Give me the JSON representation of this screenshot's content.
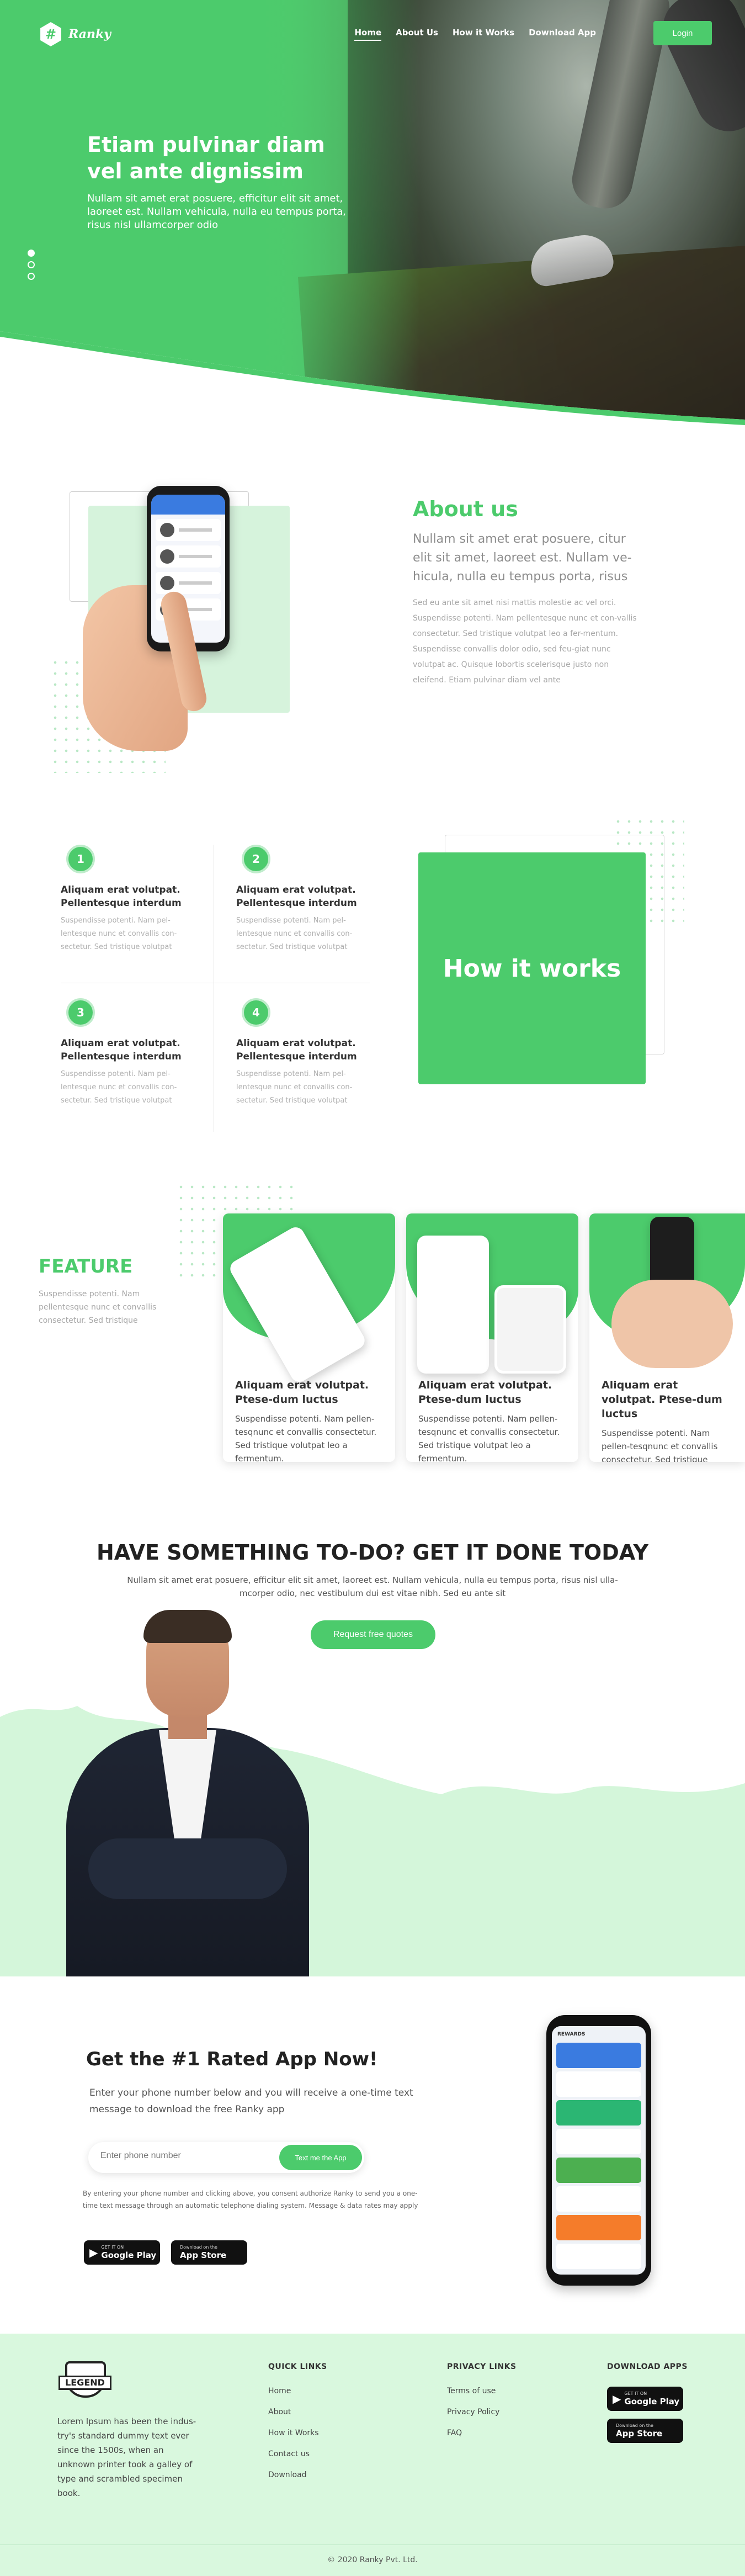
{
  "brand": {
    "name": "Ranky",
    "logo_glyph": "#"
  },
  "nav": {
    "items": [
      {
        "label": "Home",
        "active": true
      },
      {
        "label": "About Us",
        "active": false
      },
      {
        "label": "How it Works",
        "active": false
      },
      {
        "label": "Download App",
        "active": false
      }
    ],
    "login_label": "Login"
  },
  "hero": {
    "title_line1": "Etiam pulvinar diam",
    "title_line2": "vel ante dignissim",
    "subtitle": "Nullam sit amet erat posuere, efficitur elit sit amet, laoreet est. Nullam vehicula, nulla eu tempus porta, risus nisl ullamcorper odio",
    "slider_active_index": 0
  },
  "about": {
    "title": "About us",
    "lead": "Nullam sit amet erat posuere, citur elit sit amet, laoreet est. Nullam ve-hicula, nulla eu tempus porta, risus",
    "body": "Sed eu ante sit amet nisi mattis molestie ac vel orci. Suspendisse potenti. Nam pellentesque nunc et con-vallis consectetur. Sed tristique volutpat leo a fer-mentum. Suspendisse convallis dolor odio, sed feu-giat nunc volutpat ac. Quisque lobortis scelerisque justo non eleifend. Etiam pulvinar diam vel ante"
  },
  "how_it_works": {
    "title": "How it works",
    "steps": [
      {
        "number": "1",
        "title": "Aliquam erat volutpat. Pellentesque interdum",
        "text": "Suspendisse potenti. Nam pel-lentesque nunc et convallis con-sectetur. Sed tristique volutpat"
      },
      {
        "number": "2",
        "title": "Aliquam erat volutpat. Pellentesque interdum",
        "text": "Suspendisse potenti. Nam pel-lentesque nunc et convallis con-sectetur. Sed tristique volutpat"
      },
      {
        "number": "3",
        "title": "Aliquam erat volutpat. Pellentesque interdum",
        "text": "Suspendisse potenti. Nam pel-lentesque nunc et convallis con-sectetur. Sed tristique volutpat"
      },
      {
        "number": "4",
        "title": "Aliquam erat volutpat. Pellentesque interdum",
        "text": "Suspendisse potenti. Nam pel-lentesque nunc et convallis con-sectetur. Sed tristique volutpat"
      }
    ]
  },
  "feature": {
    "title": "FEATURE",
    "subtitle": "Suspendisse potenti. Nam pellentesque nunc et convallis consectetur. Sed tristique",
    "cards": [
      {
        "title": "Aliquam erat volutpat. Ptese-dum luctus",
        "text": "Suspendisse potenti. Nam pellen-tesqnunc et convallis consectetur. Sed tristique volutpat leo a fermentum."
      },
      {
        "title": "Aliquam erat volutpat. Ptese-dum luctus",
        "text": "Suspendisse potenti. Nam pellen-tesqnunc et convallis consectetur. Sed tristique volutpat leo a fermentum."
      },
      {
        "title": "Aliquam erat volutpat. Ptese-dum luctus",
        "text": "Suspendisse potenti. Nam pellen-tesqnunc et convallis consectetur. Sed tristique volutpat leo a fermentum."
      }
    ]
  },
  "cta": {
    "title": "HAVE SOMETHING TO-DO? GET IT DONE TODAY",
    "subtitle": "Nullam sit amet erat posuere, efficitur elit sit amet, laoreet est. Nullam vehicula, nulla eu tempus porta, risus nisl ulla-mcorper odio, nec vestibulum dui est vitae nibh. Sed eu ante sit",
    "button_label": "Request free quotes"
  },
  "get_app": {
    "title": "Get  the #1 Rated App Now!",
    "description": "Enter your phone number below and you will receive a one-time text message to download the free Ranky app",
    "phone_placeholder": "Enter phone number",
    "button_label": "Text me the App",
    "disclaimer": "By entering your phone number and clicking above, you consent authorize Ranky to send you a one-time text message through an automatic telephone dialing system. Message & data rates may apply",
    "phone_header": "REWARDS"
  },
  "stores": {
    "google": {
      "small": "GET IT ON",
      "big": "Google Play"
    },
    "apple": {
      "small": "Download on the",
      "big": "App Store"
    }
  },
  "footer": {
    "logo_text": "LEGEND",
    "about": "Lorem Ipsum has been the indus-try's standard dummy text ever since the 1500s, when an unknown printer took a galley of type and scrambled specimen book.",
    "quick_links": {
      "heading": "QUICK LINKS",
      "items": [
        "Home",
        "About",
        "How it Works",
        "Contact us",
        "Download"
      ]
    },
    "privacy_links": {
      "heading": "PRIVACY LINKS",
      "items": [
        "Terms of use",
        "Privacy Policy",
        "FAQ"
      ]
    },
    "download": {
      "heading": "DOWNLOAD APPS"
    },
    "copyright": "© 2020 Ranky Pvt. Ltd."
  },
  "colors": {
    "accent": "#4ccb6c",
    "light_green": "#d9f8de",
    "dark_text": "#222222"
  }
}
